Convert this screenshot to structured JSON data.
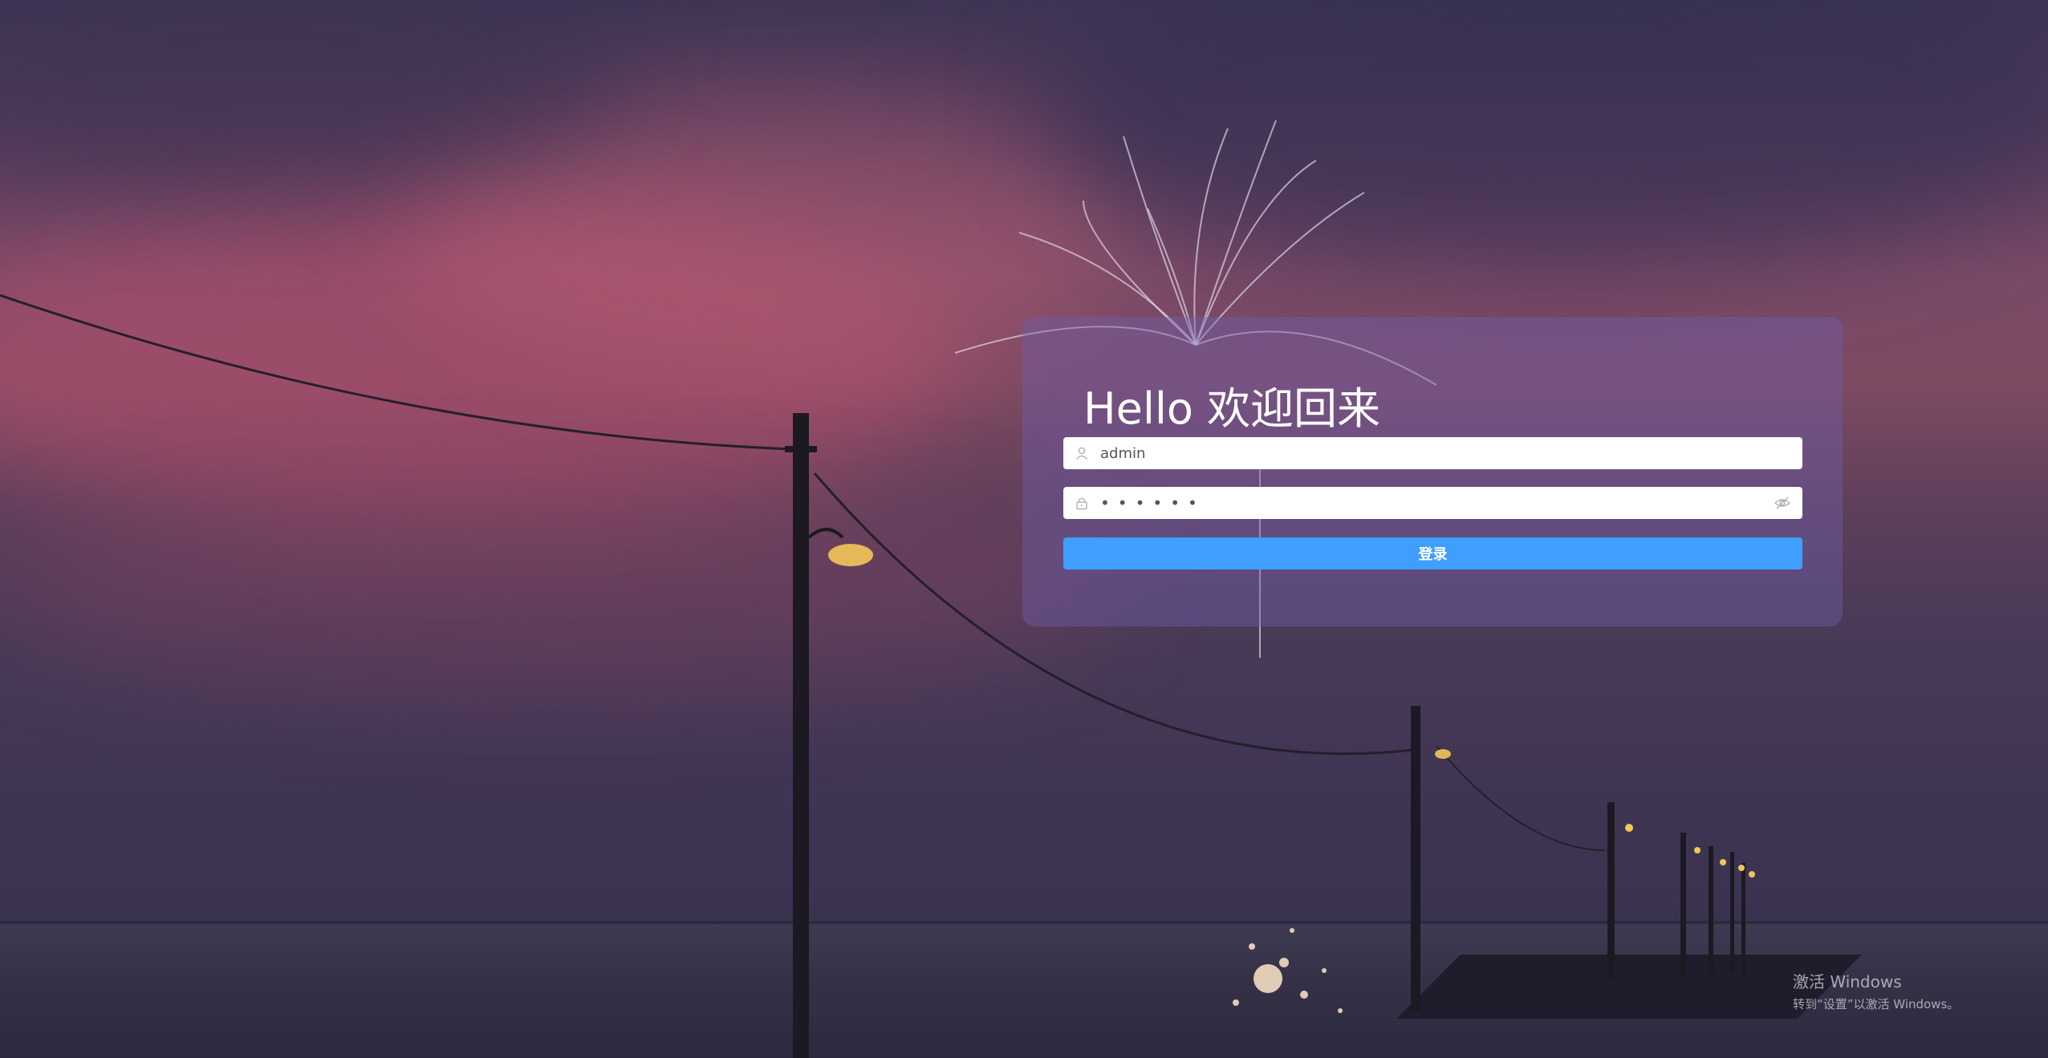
{
  "login": {
    "title": "Hello 欢迎回来",
    "username": {
      "icon": "user-icon",
      "value": "admin"
    },
    "password": {
      "icon": "lock-icon",
      "masked_value": "••••••",
      "toggle_icon": "eye-off-icon"
    },
    "submit_label": "登录"
  },
  "watermark": {
    "title": "激活 Windows",
    "subtitle": "转到“设置”以激活 Windows。"
  },
  "colors": {
    "primary_button": "#409eff",
    "card_overlay": "#6e5faf",
    "sky_pink": "#7e4a62",
    "sky_purple": "#3f3554"
  }
}
